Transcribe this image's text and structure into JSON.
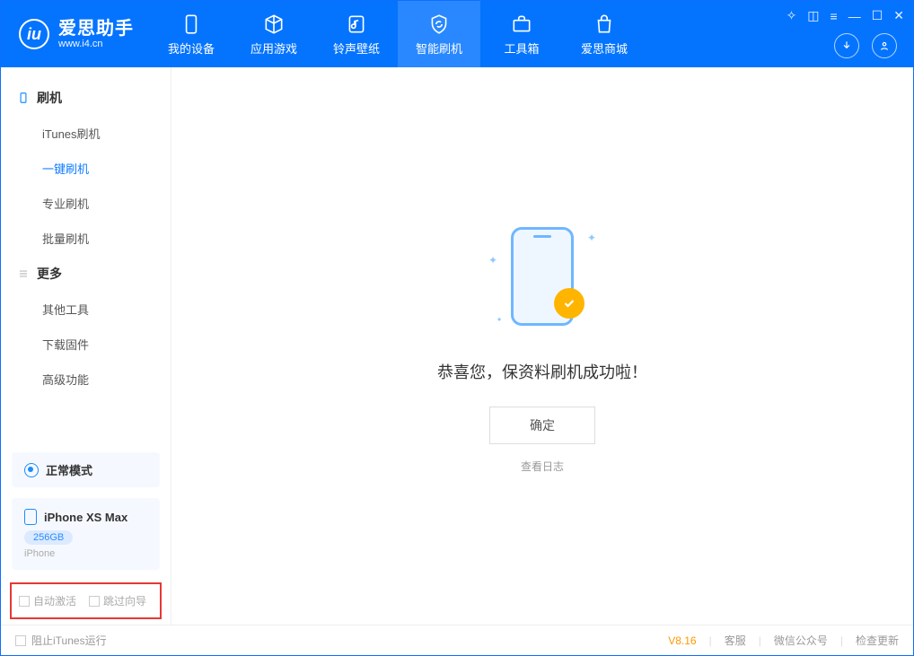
{
  "app": {
    "name": "爱思助手",
    "site": "www.i4.cn"
  },
  "nav": {
    "my_device": "我的设备",
    "apps_games": "应用游戏",
    "ring_wall": "铃声壁纸",
    "smart_flash": "智能刷机",
    "toolbox": "工具箱",
    "store": "爱思商城"
  },
  "sidebar": {
    "group_flash": "刷机",
    "items_flash": {
      "itunes": "iTunes刷机",
      "onekey": "一键刷机",
      "pro": "专业刷机",
      "batch": "批量刷机"
    },
    "group_more": "更多",
    "items_more": {
      "other_tools": "其他工具",
      "download_fw": "下载固件",
      "advanced": "高级功能"
    },
    "mode_normal": "正常模式",
    "device_name": "iPhone XS Max",
    "device_storage": "256GB",
    "device_type": "iPhone",
    "opt_auto_activate": "自动激活",
    "opt_skip_guide": "跳过向导"
  },
  "main": {
    "success_msg": "恭喜您，保资料刷机成功啦！",
    "ok": "确定",
    "view_log": "查看日志"
  },
  "footer": {
    "block_itunes": "阻止iTunes运行",
    "version": "V8.16",
    "support": "客服",
    "wechat": "微信公众号",
    "check_update": "检查更新"
  }
}
